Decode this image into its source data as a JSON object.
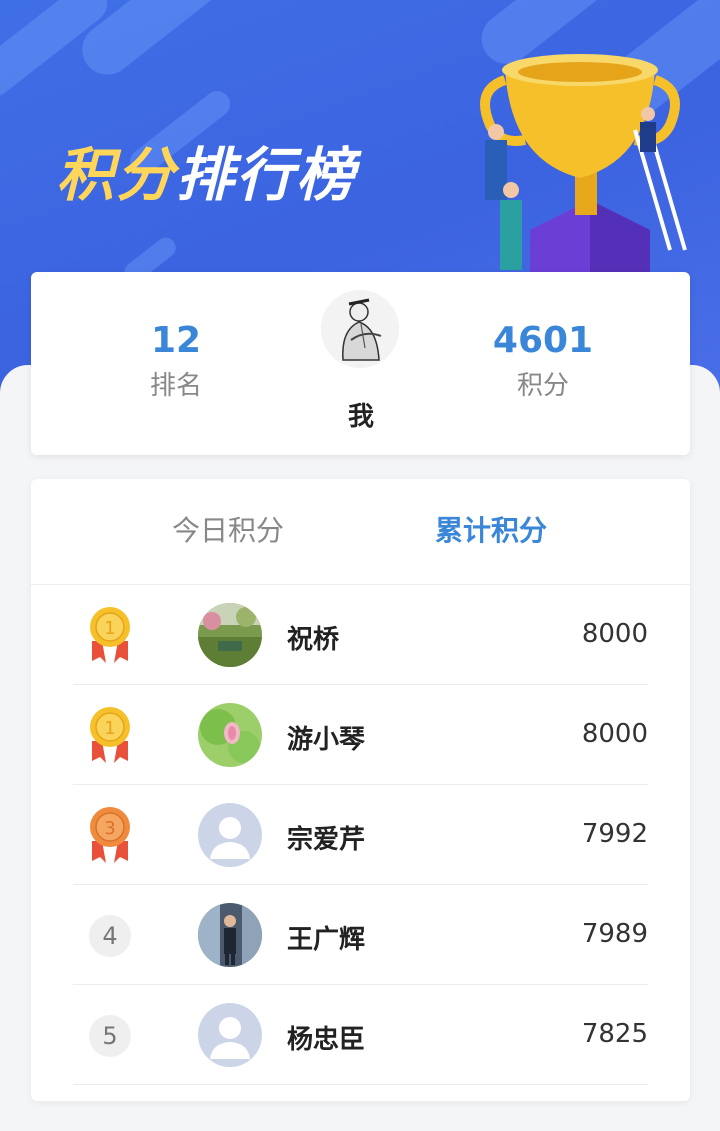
{
  "header": {
    "title_highlight": "积分",
    "title_rest": "排行榜"
  },
  "me": {
    "rank": "12",
    "rank_label": "排名",
    "points": "4601",
    "points_label": "积分",
    "name": "我"
  },
  "tabs": [
    {
      "label": "今日积分",
      "active": false
    },
    {
      "label": "累计积分",
      "active": true
    }
  ],
  "ranking": [
    {
      "rank": "1",
      "medal": "gold",
      "name": "祝桥",
      "score": "8000",
      "avatar": "photo-garden"
    },
    {
      "rank": "1",
      "medal": "gold",
      "name": "游小琴",
      "score": "8000",
      "avatar": "photo-lotus"
    },
    {
      "rank": "3",
      "medal": "bronze",
      "name": "宗爱芹",
      "score": "7992",
      "avatar": "default-user"
    },
    {
      "rank": "4",
      "medal": "",
      "name": "王广辉",
      "score": "7989",
      "avatar": "photo-person"
    },
    {
      "rank": "5",
      "medal": "",
      "name": "杨忠臣",
      "score": "7825",
      "avatar": "default-user"
    }
  ],
  "colors": {
    "header_blue": "#3f6fe6",
    "accent_blue": "#3a86d8",
    "gold": "#f6c02a",
    "bronze": "#f08a3c",
    "ribbon": "#e8503a"
  }
}
